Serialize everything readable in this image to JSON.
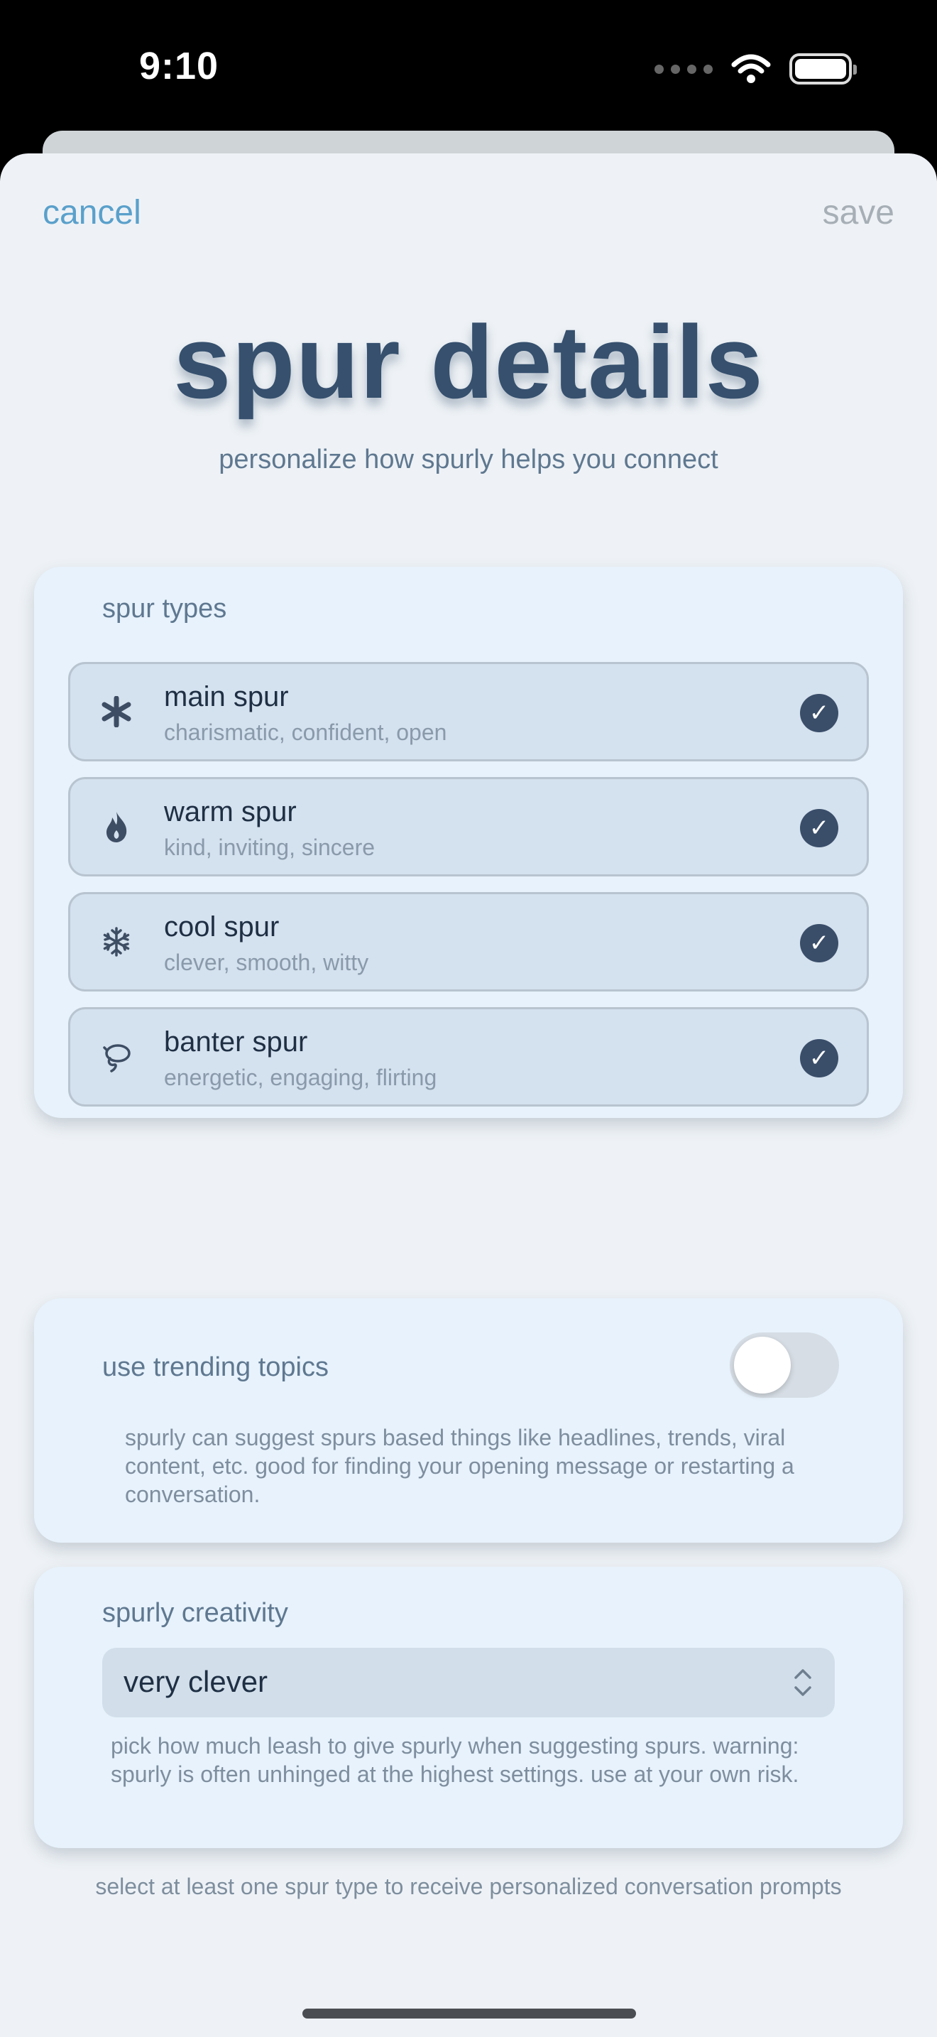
{
  "status_bar": {
    "time": "9:10"
  },
  "nav": {
    "cancel_label": "cancel",
    "save_label": "save"
  },
  "header": {
    "title": "spur details",
    "subtitle": "personalize how spurly helps you connect"
  },
  "spur_types": {
    "label": "spur types",
    "items": [
      {
        "icon": "asterisk-icon",
        "glyph": "✱",
        "name": "main spur",
        "description": "charismatic, confident, open",
        "checked": true
      },
      {
        "icon": "flame-icon",
        "glyph": "🔥",
        "name": "warm spur",
        "description": "kind, inviting, sincere",
        "checked": true
      },
      {
        "icon": "snowflake-icon",
        "glyph": "❄",
        "name": "cool spur",
        "description": "clever, smooth, witty",
        "checked": true
      },
      {
        "icon": "lasso-icon",
        "glyph": "➰",
        "name": "banter spur",
        "description": "energetic, engaging, flirting",
        "checked": true
      }
    ]
  },
  "trending": {
    "label": "use trending topics",
    "enabled": false,
    "description": "spurly can suggest spurs based things like headlines, trends, viral content, etc. good for finding your opening message or restarting a conversation."
  },
  "creativity": {
    "label": "spurly creativity",
    "selected": "very clever",
    "description": "pick how much leash to give spurly when suggesting spurs. warning: spurly is often unhinged at the highest settings. use at your own risk."
  },
  "footer_note": "select at least one spur type to receive personalized conversation prompts"
}
